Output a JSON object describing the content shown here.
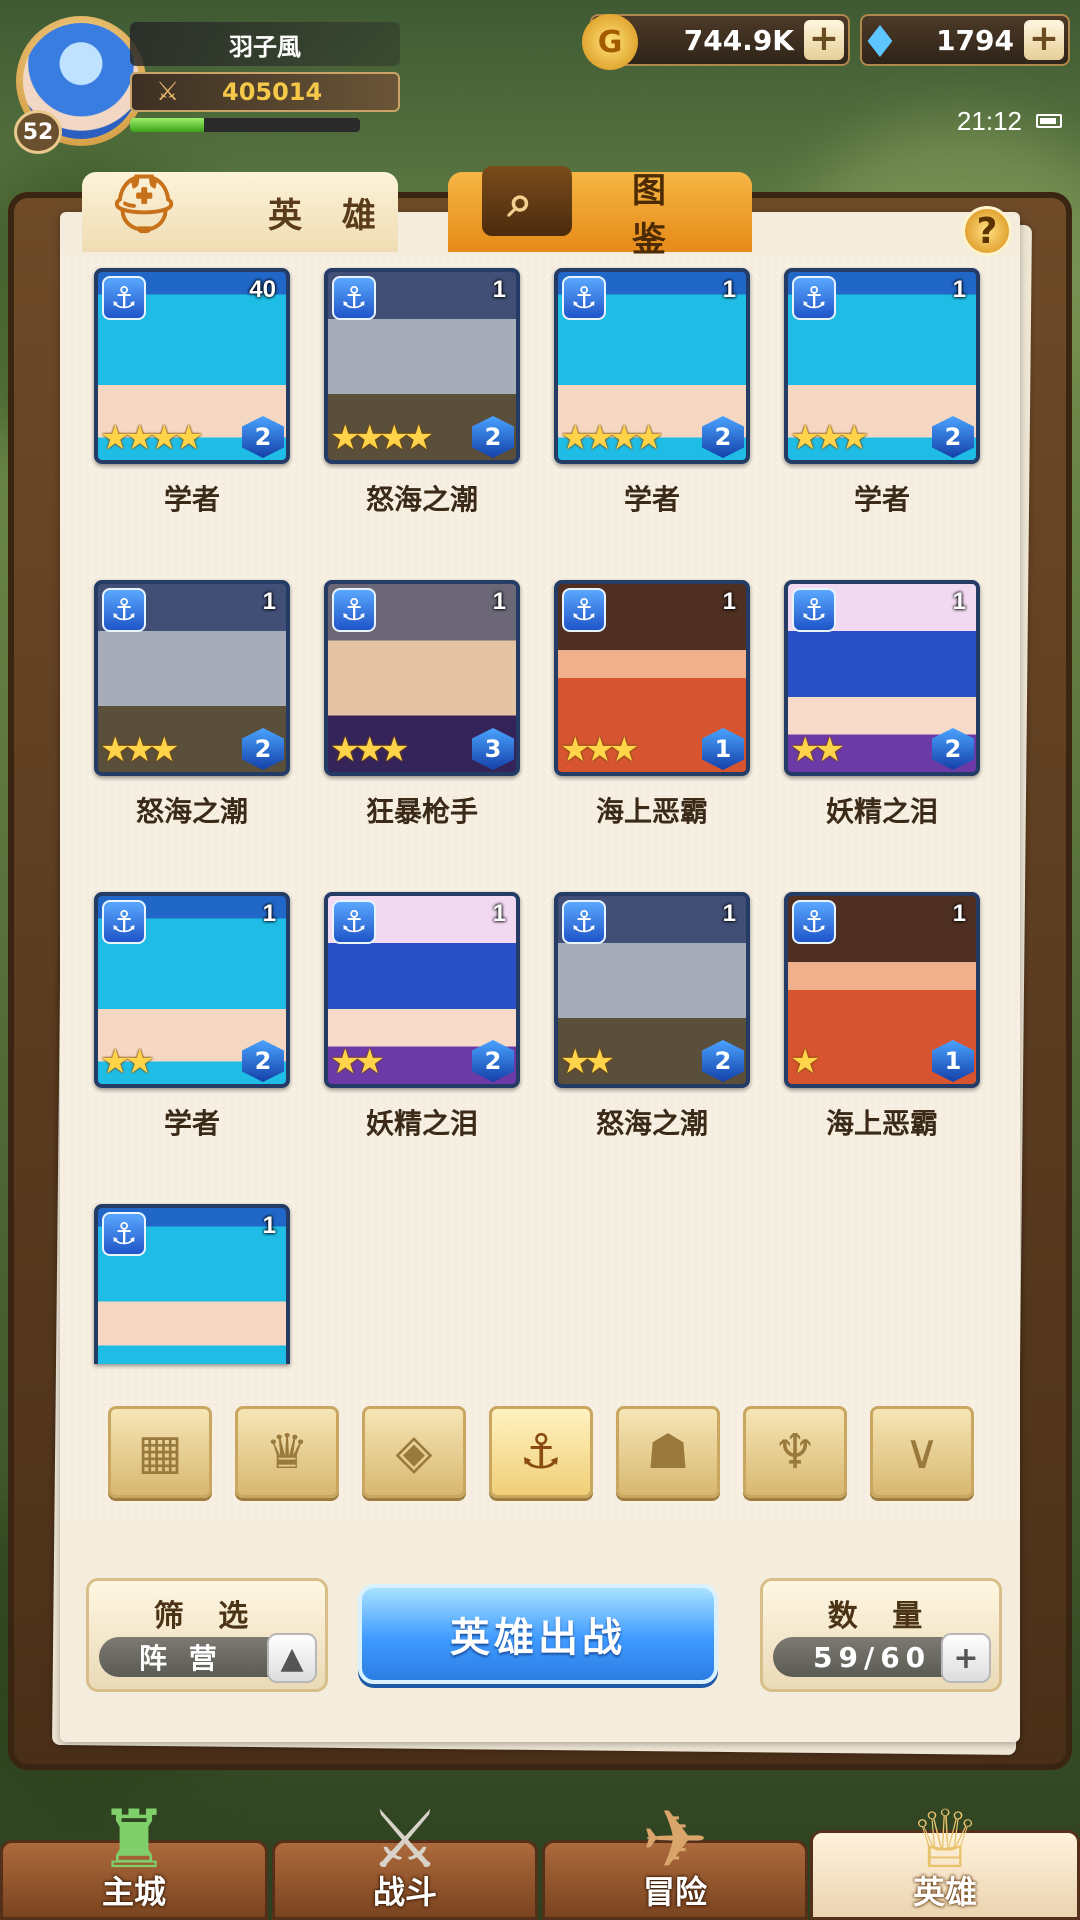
{
  "player": {
    "name": "羽子風",
    "level": "52",
    "power": "405014",
    "xp_fraction": 0.32
  },
  "resources": {
    "gold": "744.9K",
    "gems": "1794"
  },
  "status": {
    "time": "21:12"
  },
  "tabs": [
    {
      "label": "英 雄",
      "icon": "helmet-icon",
      "active": true
    },
    {
      "label": "图 鉴",
      "icon": "magnifier-icon",
      "active": false
    }
  ],
  "help_label": "?",
  "heroes": [
    {
      "name": "学者",
      "type": "scholar",
      "level": "40",
      "stars": "★★★★",
      "rank": "2"
    },
    {
      "name": "怒海之潮",
      "type": "knight",
      "level": "1",
      "stars": "★★★★",
      "rank": "2"
    },
    {
      "name": "学者",
      "type": "scholar",
      "level": "1",
      "stars": "★★★★",
      "rank": "2"
    },
    {
      "name": "学者",
      "type": "scholar",
      "level": "1",
      "stars": "★★★",
      "rank": "2"
    },
    {
      "name": "怒海之潮",
      "type": "knight",
      "level": "1",
      "stars": "★★★",
      "rank": "2"
    },
    {
      "name": "狂暴枪手",
      "type": "gunner",
      "level": "1",
      "stars": "★★★",
      "rank": "3"
    },
    {
      "name": "海上恶霸",
      "type": "pirate",
      "level": "1",
      "stars": "★★★",
      "rank": "1"
    },
    {
      "name": "妖精之泪",
      "type": "fairy",
      "level": "1",
      "stars": "★★",
      "rank": "2"
    },
    {
      "name": "学者",
      "type": "scholar",
      "level": "1",
      "stars": "★★",
      "rank": "2"
    },
    {
      "name": "妖精之泪",
      "type": "fairy",
      "level": "1",
      "stars": "★★",
      "rank": "2"
    },
    {
      "name": "怒海之潮",
      "type": "knight",
      "level": "1",
      "stars": "★★",
      "rank": "2"
    },
    {
      "name": "海上恶霸",
      "type": "pirate",
      "level": "1",
      "stars": "★",
      "rank": "1"
    },
    {
      "name": "",
      "type": "scholar",
      "level": "1",
      "stars": "",
      "rank": ""
    }
  ],
  "faction_filters": [
    {
      "icon": "grid-all-icon",
      "glyph": "▦",
      "active": false
    },
    {
      "icon": "flame-faction-icon",
      "glyph": "♛",
      "active": false
    },
    {
      "icon": "diamond-faction-icon",
      "glyph": "◈",
      "active": false
    },
    {
      "icon": "anchor-faction-icon",
      "glyph": "⚓",
      "active": true
    },
    {
      "icon": "beast-faction-icon",
      "glyph": "☗",
      "active": false
    },
    {
      "icon": "horn-faction-icon",
      "glyph": "♆",
      "active": false
    },
    {
      "icon": "wing-faction-icon",
      "glyph": "∨",
      "active": false
    }
  ],
  "controls": {
    "filter_label": "筛 选",
    "filter_value": "阵 营",
    "deploy_label": "英雄出战",
    "count_label": "数 量",
    "count_value": "59/60"
  },
  "nav": [
    {
      "label": "主城",
      "icon": "castle-icon",
      "glyph": "♜",
      "active": false
    },
    {
      "label": "战斗",
      "icon": "crossed-swords-icon",
      "glyph": "⚔",
      "active": false
    },
    {
      "label": "冒险",
      "icon": "map-scroll-icon",
      "glyph": "✈",
      "active": false
    },
    {
      "label": "英雄",
      "icon": "hero-crest-icon",
      "glyph": "♕",
      "active": true
    }
  ]
}
